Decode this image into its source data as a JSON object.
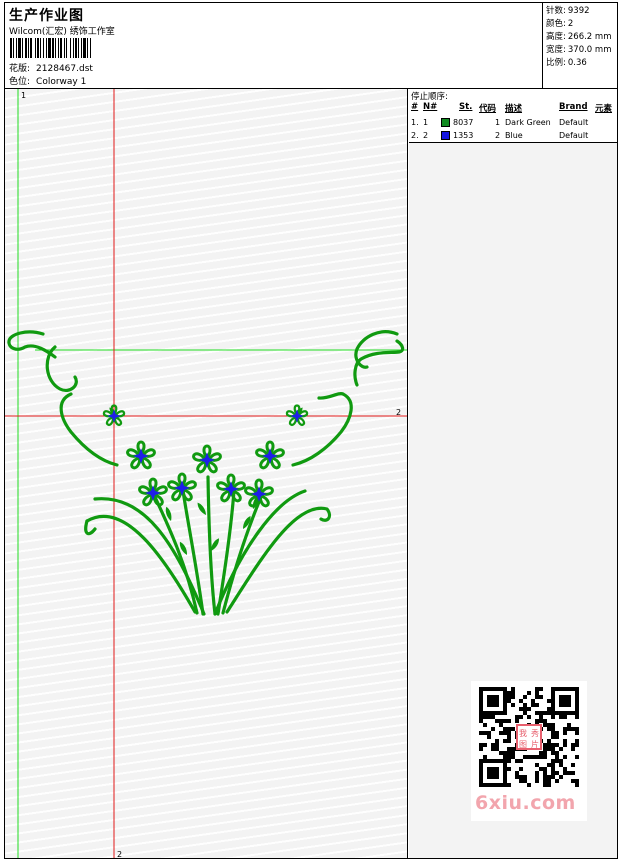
{
  "header": {
    "title": "生产作业图",
    "company": "Wilcom(汇宏) 绣饰工作室",
    "pattern_label": "花版:",
    "pattern_value": "2128467.dst",
    "colorway_label": "色位:",
    "colorway_value": "Colorway 1"
  },
  "stats": {
    "stitches_label": "针数:",
    "stitches_value": "9392",
    "colors_label": "颜色:",
    "colors_value": "2",
    "height_label": "高度:",
    "height_value": "266.2 mm",
    "width_label": "宽度:",
    "width_value": "370.0 mm",
    "scale_label": "比例:",
    "scale_value": "0.36"
  },
  "design": {
    "guide_v_green_label": "1",
    "guide_h_red_label": "2",
    "guide_v_red_label": "2",
    "colors": {
      "green": "#109a10",
      "blue": "#1f1fe8",
      "guide_green": "#22dd22",
      "guide_red": "#e01818"
    }
  },
  "stop_sequence": {
    "title": "停止顺序:",
    "columns": [
      "#",
      "N#",
      "St.",
      "代码",
      "描述",
      "Brand",
      "元素"
    ],
    "rows": [
      {
        "num": "1.",
        "n": "1",
        "color": "#0f8a1f",
        "st": "8037",
        "code": "1",
        "desc": "Dark Green",
        "brand": "Default"
      },
      {
        "num": "2.",
        "n": "2",
        "color": "#1515e0",
        "st": "1353",
        "code": "2",
        "desc": "Blue",
        "brand": "Default"
      }
    ]
  },
  "watermark": {
    "text": "6xiu.com",
    "seal_text": "我秀图片"
  }
}
